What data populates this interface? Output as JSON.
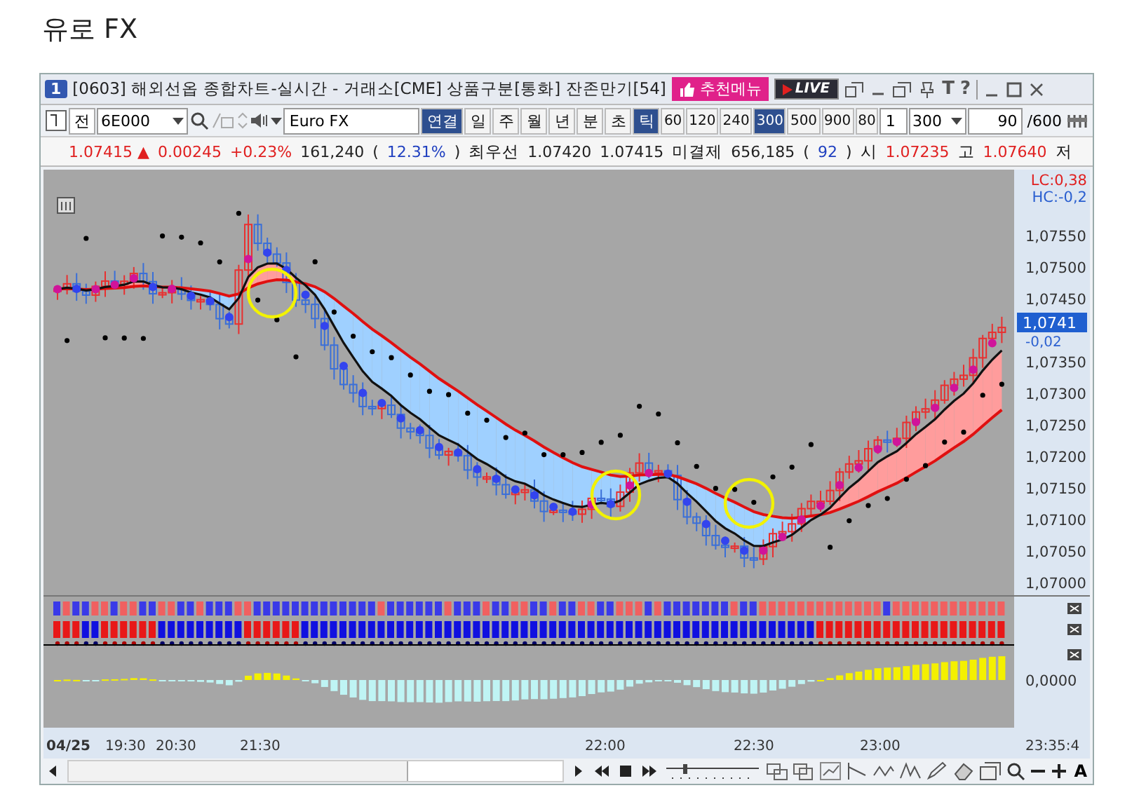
{
  "page_title": "유로 FX",
  "window": {
    "badge": "1",
    "title": "[0603] 해외선옵 종합차트-실시간 - 거래소[CME] 상품구분[통화] 잔존만기[54]",
    "recommend_button": "추천메뉴",
    "live_button": "LIVE",
    "help_glyphs": [
      "T",
      "?"
    ]
  },
  "toolbar": {
    "prefix": "전",
    "code": "6E000",
    "name": "Euro FX",
    "period_tabs": [
      {
        "label": "연결",
        "selected": true
      },
      {
        "label": "일",
        "selected": false
      },
      {
        "label": "주",
        "selected": false
      },
      {
        "label": "월",
        "selected": false
      },
      {
        "label": "년",
        "selected": false
      },
      {
        "label": "분",
        "selected": false
      },
      {
        "label": "초",
        "selected": false
      },
      {
        "label": "틱",
        "selected": true
      }
    ],
    "intervals": [
      {
        "label": "60",
        "selected": false
      },
      {
        "label": "120",
        "selected": false
      },
      {
        "label": "240",
        "selected": false
      },
      {
        "label": "300",
        "selected": true
      },
      {
        "label": "500",
        "selected": false
      },
      {
        "label": "900",
        "selected": false
      },
      {
        "label": "80",
        "selected": false
      }
    ],
    "count": "1",
    "tick_value": "300",
    "view_count": "90",
    "view_total": "/600"
  },
  "quote_bar": [
    {
      "kind": "up",
      "text": "1.07415 ▲"
    },
    {
      "kind": "up",
      "text": "0.00245"
    },
    {
      "kind": "up",
      "text": "+0.23%"
    },
    {
      "kind": "plain",
      "text": "161,240"
    },
    {
      "kind": "plain",
      "text": "("
    },
    {
      "kind": "info",
      "text": "12.31%"
    },
    {
      "kind": "plain",
      "text": ")"
    },
    {
      "kind": "label",
      "text": "최우선"
    },
    {
      "kind": "plain",
      "text": "1.07420"
    },
    {
      "kind": "plain",
      "text": "1.07415"
    },
    {
      "kind": "label",
      "text": "미결제"
    },
    {
      "kind": "plain",
      "text": "656,185"
    },
    {
      "kind": "plain",
      "text": "("
    },
    {
      "kind": "info",
      "text": "92"
    },
    {
      "kind": "plain",
      "text": ")"
    },
    {
      "kind": "label",
      "text": "시"
    },
    {
      "kind": "up",
      "text": "1.07235"
    },
    {
      "kind": "label",
      "text": "고"
    },
    {
      "kind": "up",
      "text": "1.07640"
    },
    {
      "kind": "label",
      "text": "저"
    }
  ],
  "chart": {
    "lc_label": "LC:0,38",
    "hc_label": "HC:-0,2",
    "price_ticks": [
      "1,07550",
      "1,07500",
      "1,07450",
      "1,07350",
      "1,07300",
      "1,07250",
      "1,07200",
      "1,07150",
      "1,07100",
      "1,07050",
      "1,07000"
    ],
    "last_price": "1,0741",
    "last_change": "-0,02",
    "oscillator_tick": "0,0000",
    "time_labels": [
      "04/25",
      "19:30",
      "20:30",
      "21:30",
      "22:00",
      "22:30",
      "23:00",
      "23:35:4"
    ]
  },
  "bottom_bar": {
    "font_button": "A"
  }
}
